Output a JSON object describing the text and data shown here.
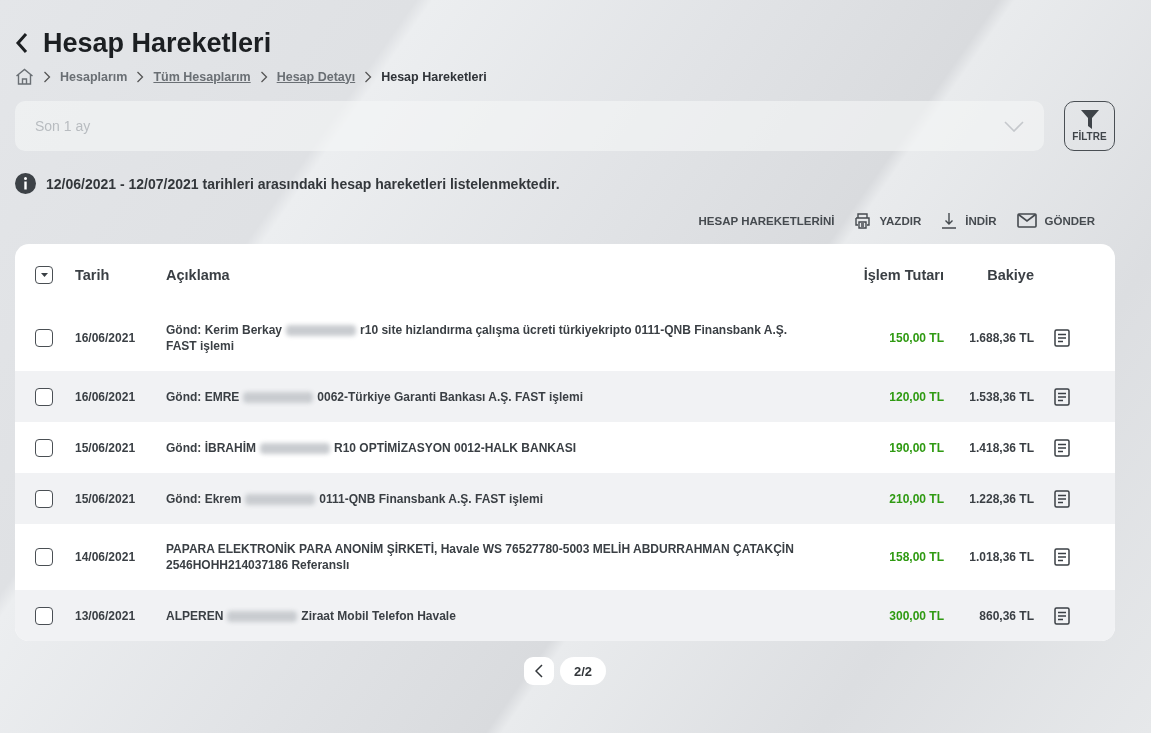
{
  "header": {
    "title": "Hesap Hareketleri"
  },
  "breadcrumb": [
    {
      "label": "Hesaplarım",
      "link": false
    },
    {
      "label": "Tüm Hesaplarım",
      "link": true
    },
    {
      "label": "Hesap Detayı",
      "link": true
    },
    {
      "label": "Hesap Hareketleri",
      "link": false
    }
  ],
  "period_select": {
    "placeholder": "Son 1 ay"
  },
  "filter_button": {
    "label": "FİLTRE"
  },
  "info": "12/06/2021 - 12/07/2021 tarihleri arasındaki hesap hareketleri listelenmektedir.",
  "actions": [
    {
      "kind": "label",
      "label": "HESAP HAREKETLERİNİ"
    },
    {
      "kind": "print",
      "label": "YAZDIR"
    },
    {
      "kind": "download",
      "label": "İNDİR"
    },
    {
      "kind": "mail",
      "label": "GÖNDER"
    }
  ],
  "table": {
    "columns": [
      "Tarih",
      "Açıklama",
      "İşlem Tutarı",
      "Bakiye"
    ],
    "rows": [
      {
        "checked": false,
        "date": "16/06/2021",
        "text_before": "Gönd: Kerim Berkay",
        "redacted": true,
        "text_after": "r10 site hizlandırma çalışma ücreti türkiyekripto 0111-QNB Finansbank A.Ş. FAST işlemi",
        "amount": "150,00 TL",
        "balance": "1.688,36 TL"
      },
      {
        "checked": false,
        "date": "16/06/2021",
        "text_before": "Gönd: EMRE",
        "redacted": true,
        "text_after": "0062-Türkiye Garanti Bankası A.Ş. FAST işlemi",
        "amount": "120,00 TL",
        "balance": "1.538,36 TL"
      },
      {
        "checked": false,
        "date": "15/06/2021",
        "text_before": "Gönd: İBRAHİM",
        "redacted": true,
        "text_after": "R10 OPTİMİZASYON 0012-HALK BANKASI",
        "amount": "190,00 TL",
        "balance": "1.418,36 TL"
      },
      {
        "checked": false,
        "date": "15/06/2021",
        "text_before": "Gönd: Ekrem",
        "redacted": true,
        "text_after": "0111-QNB Finansbank A.Ş. FAST işlemi",
        "amount": "210,00 TL",
        "balance": "1.228,36 TL"
      },
      {
        "checked": false,
        "date": "14/06/2021",
        "text_before": "PAPARA ELEKTRONİK PARA ANONİM ŞİRKETİ, Havale WS 76527780-5003 MELİH ABDURRAHMAN ÇATAKÇİN 2546HOHH214037186 Referanslı",
        "redacted": false,
        "text_after": "",
        "amount": "158,00 TL",
        "balance": "1.018,36 TL"
      },
      {
        "checked": false,
        "date": "13/06/2021",
        "text_before": "ALPEREN",
        "redacted": true,
        "text_after": "Ziraat Mobil Telefon Havale",
        "amount": "300,00 TL",
        "balance": "860,36 TL"
      }
    ]
  },
  "pagination": {
    "page": "2/2"
  }
}
